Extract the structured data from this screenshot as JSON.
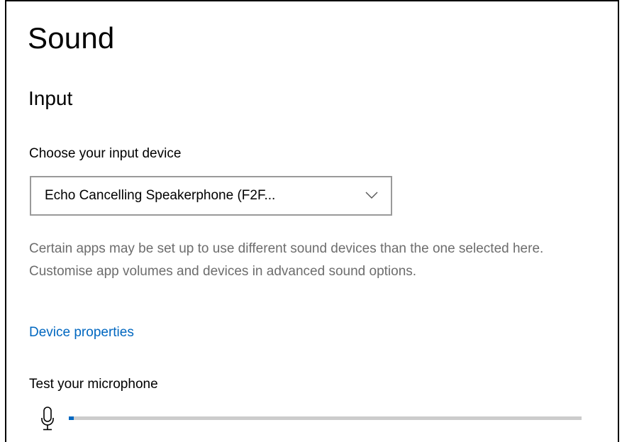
{
  "page": {
    "title": "Sound"
  },
  "input": {
    "section_title": "Input",
    "choose_label": "Choose your input device",
    "dropdown": {
      "selected": "Echo Cancelling Speakerphone (F2F...",
      "icon": "chevron-down-icon"
    },
    "info_text": "Certain apps may be set up to use different sound devices than the one selected here. Customise app volumes and devices in advanced sound options.",
    "device_properties_link": "Device properties",
    "test_label": "Test your microphone",
    "mic_icon": "microphone-icon",
    "mic_level": 0.01
  },
  "colors": {
    "accent": "#0067c0",
    "secondary_text": "#6d6d6d",
    "meter_track": "#cccccc",
    "dropdown_border": "#9a9a9a"
  }
}
